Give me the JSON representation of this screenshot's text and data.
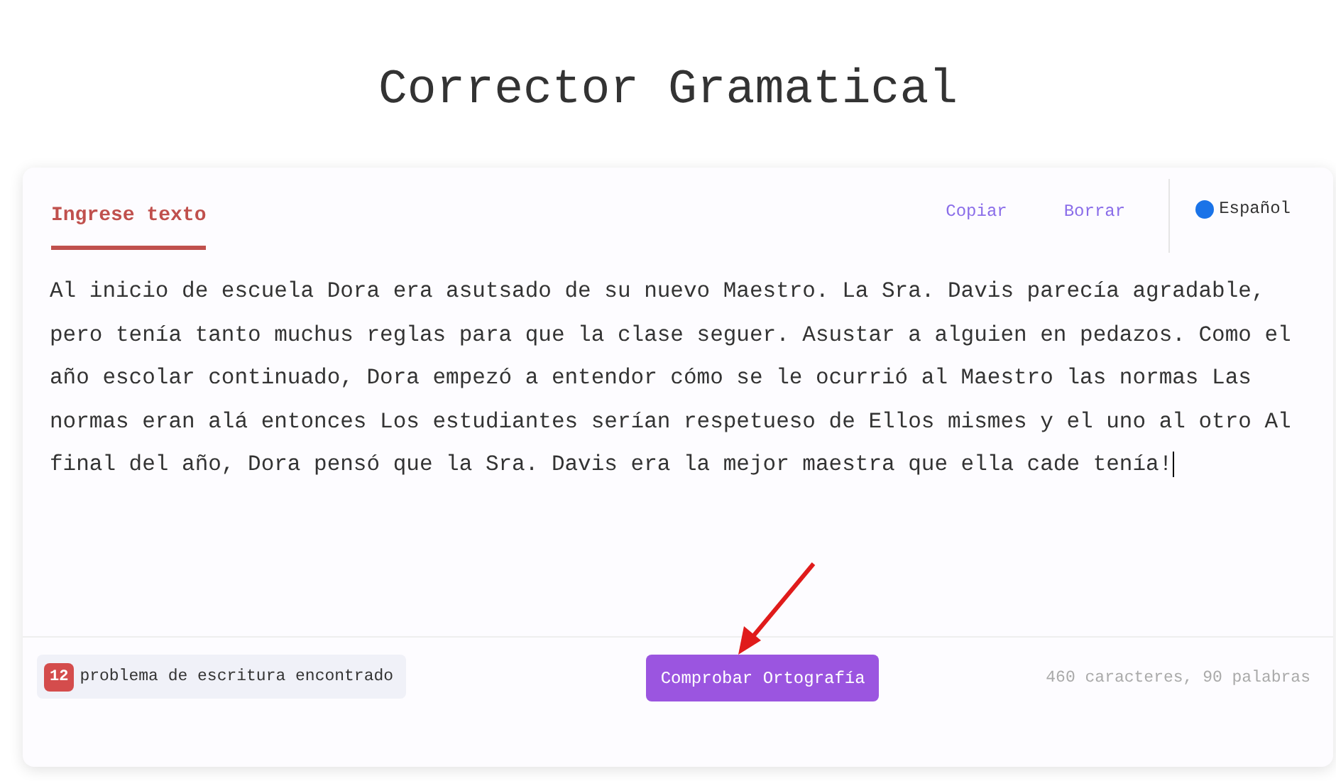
{
  "title": "Corrector Gramatical",
  "tabs": [
    {
      "label": "Ingrese texto",
      "selected": true
    }
  ],
  "actions": [
    "Copiar",
    "Borrar"
  ],
  "language": {
    "label": "Español",
    "color": "#1a73e8"
  },
  "text": "Al inicio de escuela Dora era asutsado de su nuevo Maestro. La Sra. Davis parecía agradable, pero tenía tanto muchus reglas para que la clase seguer. Asustar a alguien en pedazos. Como el año escolar continuado, Dora empezó a entendor cómo se le ocurrió al Maestro las normas Las normas eran alá entonces Los estudiantes serían respetueso de Ellos mismes y el uno al otro Al final del año, Dora pensó que la Sra. Davis era la mejor maestra que ella cade tenía!",
  "issues": {
    "count": "12",
    "label": "problema de escritura encontrado"
  },
  "check_button": "Comprobar Ortografía",
  "stats": "460 caracteres, 90 palabras"
}
